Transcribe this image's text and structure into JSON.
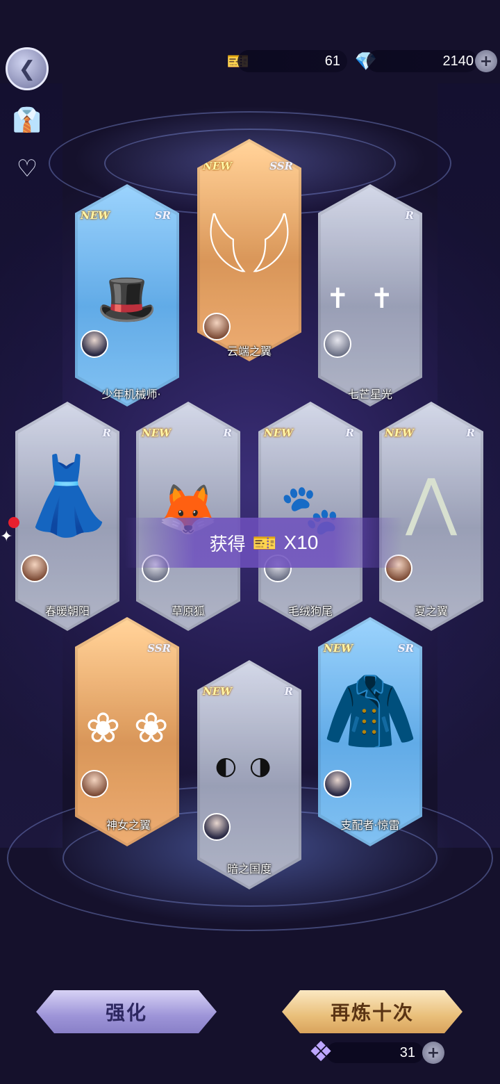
{
  "currency": {
    "tickets": "61",
    "crystals": "2140"
  },
  "banner": {
    "label": "获得",
    "quantity": "X10"
  },
  "cards": [
    {
      "name": "云端之翼",
      "rarity": "SSR",
      "new": "NEW",
      "art": "wings-icon"
    },
    {
      "name": "少年机械师·",
      "rarity": "SR",
      "new": "NEW",
      "art": "hat-icon"
    },
    {
      "name": "七芒星光",
      "rarity": "R",
      "new": "",
      "art": "cross-earrings-icon"
    },
    {
      "name": "春暖朝阳",
      "rarity": "R",
      "new": "",
      "art": "dress-icon"
    },
    {
      "name": "草原狐",
      "rarity": "R",
      "new": "NEW",
      "art": "fox-tail-icon"
    },
    {
      "name": "毛绒狗尾",
      "rarity": "R",
      "new": "NEW",
      "art": "dog-tail-icon"
    },
    {
      "name": "夏之翼",
      "rarity": "R",
      "new": "NEW",
      "art": "leaf-wings-icon"
    },
    {
      "name": "神女之翼",
      "rarity": "SSR",
      "new": "",
      "art": "flower-wings-icon"
    },
    {
      "name": "暗之国度",
      "rarity": "R",
      "new": "NEW",
      "art": "earrings-icon"
    },
    {
      "name": "支配者·惊雷",
      "rarity": "SR",
      "new": "NEW",
      "art": "suit-icon"
    }
  ],
  "buttons": {
    "enhance": "强化",
    "refine_ten": "再炼十次"
  },
  "refine_crystals": "31",
  "icons": {
    "ticket": "ticket-icon",
    "crystal": "blue-crystal-icon",
    "plus": "plus-icon",
    "back": "back-icon",
    "wardrobe": "wardrobe-icon",
    "share": "share-heart-icon"
  },
  "colors": {
    "ssr": "#c98b52",
    "sr": "#5a9ed6",
    "r": "#8e93a8",
    "banner": "#6e50be"
  }
}
